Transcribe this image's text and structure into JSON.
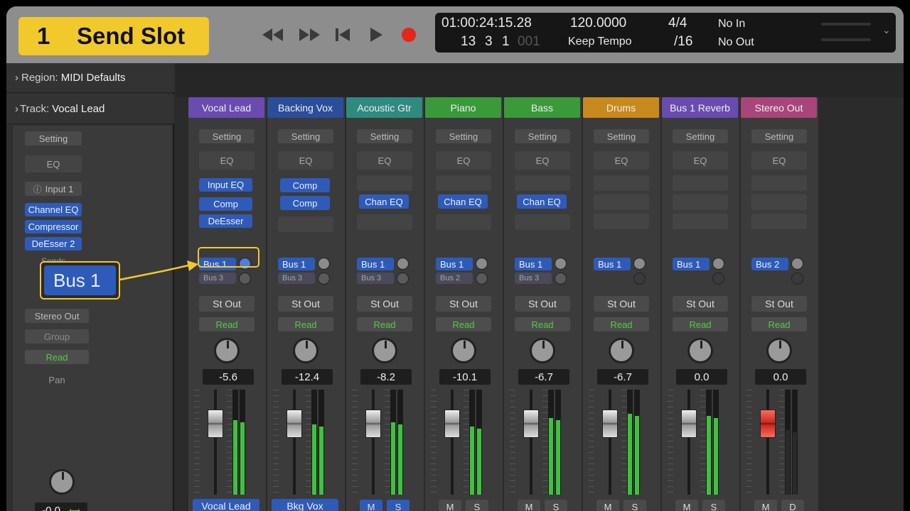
{
  "badge": {
    "number": "1",
    "label": "Send Slot"
  },
  "transport": {
    "buttons": [
      "rewind",
      "fast-forward",
      "go-to-start",
      "play",
      "record"
    ]
  },
  "lcd": {
    "timecode": "01:00:24:15.28",
    "bars": "13",
    "beats": "3",
    "div": "1",
    "ticks": "001",
    "tempo": "120.0000",
    "tempo_mode": "Keep Tempo",
    "signature": "4/4",
    "division": "/16",
    "midi_in": "No In",
    "midi_out": "No Out"
  },
  "inspector": {
    "region_label": "Region:",
    "region_value": "MIDI Defaults",
    "track_label": "Track:",
    "track_value": "Vocal Lead",
    "setting": "Setting",
    "eq": "EQ",
    "input": "Input 1",
    "plugins": [
      "Channel EQ",
      "Compressor",
      "DeEsser 2"
    ],
    "sends_label": "Sends",
    "output": "Stereo Out",
    "group": "Group",
    "automation": "Read",
    "pan_label": "Pan",
    "pan_value": "-0.0"
  },
  "callout": {
    "label": "Bus 1"
  },
  "strip_common": {
    "setting": "Setting",
    "eq": "EQ",
    "output": "St Out",
    "automation": "Read",
    "mute": "M",
    "solo": "S",
    "dim": "D"
  },
  "strips": [
    {
      "name": "Vocal Lead",
      "color": "#6a4bb0",
      "input": "Input EQ",
      "plugins": [
        "Comp",
        "DeEsser"
      ],
      "send1": "Bus 1",
      "send2": "Bus 3",
      "volume": "-5.6",
      "footer": "Vocal Lead",
      "meter": 0.72
    },
    {
      "name": "Backing Vox",
      "color": "#2a4e9a",
      "plugins": [
        "Comp",
        "Comp"
      ],
      "send1": "Bus 1",
      "send2": "Bus 3",
      "volume": "-12.4",
      "footer": "Bkg Vox",
      "meter": 0.68
    },
    {
      "name": "Acoustic Gtr",
      "color": "#2f8a80",
      "plugins": [
        "Chan EQ"
      ],
      "send1": "Bus 1",
      "send2": "Bus 3",
      "volume": "-8.2",
      "meter": 0.7
    },
    {
      "name": "Piano",
      "color": "#3a9a3a",
      "plugins": [
        "Chan EQ"
      ],
      "send1": "Bus 1",
      "send2": "Bus 2",
      "volume": "-10.1",
      "meter": 0.66
    },
    {
      "name": "Bass",
      "color": "#3a9a3a",
      "plugins": [
        "Chan EQ"
      ],
      "send1": "Bus 1",
      "send2": "Bus 3",
      "volume": "-6.7",
      "meter": 0.74
    },
    {
      "name": "Drums",
      "color": "#c8891e",
      "plugins": [],
      "send1": "Bus 1",
      "send2": "",
      "volume": "-6.7",
      "meter": 0.78
    },
    {
      "name": "Bus 1 Reverb",
      "color": "#6a4bb0",
      "plugins": [],
      "send1": "Bus 1",
      "send2": "",
      "volume": "0.0",
      "meter": 0.76
    },
    {
      "name": "Stereo Out",
      "color": "#a8457a",
      "plugins": [],
      "send1": "Bus 2",
      "send2": "",
      "volume": "0.0",
      "meter": 0.62
    }
  ]
}
